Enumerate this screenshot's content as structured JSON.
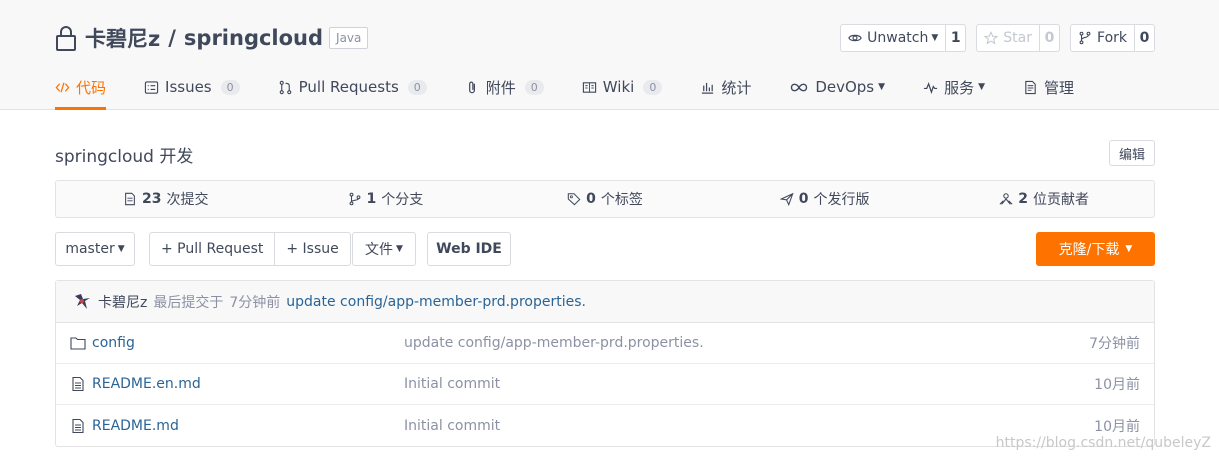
{
  "repo": {
    "owner": "卡碧尼z",
    "separator": "/",
    "name": "springcloud",
    "language": "Java"
  },
  "actions": {
    "watch": {
      "label": "Unwatch",
      "count": "1"
    },
    "star": {
      "label": "Star",
      "count": "0"
    },
    "fork": {
      "label": "Fork",
      "count": "0"
    }
  },
  "tabs": [
    {
      "label": "代码"
    },
    {
      "label": "Issues",
      "count": "0"
    },
    {
      "label": "Pull Requests",
      "count": "0"
    },
    {
      "label": "附件",
      "count": "0"
    },
    {
      "label": "Wiki",
      "count": "0"
    },
    {
      "label": "统计"
    },
    {
      "label": "DevOps"
    },
    {
      "label": "服务"
    },
    {
      "label": "管理"
    }
  ],
  "description": "springcloud 开发",
  "edit_label": "编辑",
  "stats": [
    {
      "num": "23",
      "label": "次提交"
    },
    {
      "num": "1",
      "label": "个分支"
    },
    {
      "num": "0",
      "label": "个标签"
    },
    {
      "num": "0",
      "label": "个发行版"
    },
    {
      "num": "2",
      "label": "位贡献者"
    }
  ],
  "toolbar": {
    "branch": "master",
    "pull_request": "+ Pull Request",
    "issue": "+ Issue",
    "file": "文件",
    "web_ide": "Web IDE",
    "clone": "克隆/下载"
  },
  "last_commit": {
    "author": "卡碧尼z",
    "prefix": "最后提交于",
    "time": "7分钟前",
    "message": "update config/app-member-prd.properties."
  },
  "files": [
    {
      "name": "config",
      "type": "folder",
      "message": "update config/app-member-prd.properties.",
      "time": "7分钟前"
    },
    {
      "name": "README.en.md",
      "type": "file",
      "message": "Initial commit",
      "time": "10月前"
    },
    {
      "name": "README.md",
      "type": "file",
      "message": "Initial commit",
      "time": "10月前"
    }
  ],
  "watermark": "https://blog.csdn.net/qubeleyZ",
  "colors": {
    "accent": "#fe7300",
    "link": "#2a6496",
    "text": "#40485b",
    "muted": "#8c92a4"
  }
}
